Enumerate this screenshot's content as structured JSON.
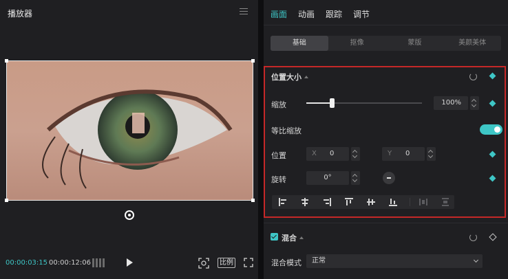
{
  "player": {
    "title": "播放器",
    "current_time": "00:00:03:15",
    "total_time": "00:00:12:06",
    "ratio_label": "比例"
  },
  "tabs": [
    "画面",
    "动画",
    "跟踪",
    "调节"
  ],
  "subtabs": [
    "基础",
    "抠像",
    "蒙版",
    "美颜美体"
  ],
  "position_size": {
    "title": "位置大小",
    "scale_label": "缩放",
    "scale_value": "100%",
    "scale_fraction": 0.22,
    "uniform_scale_label": "等比缩放",
    "uniform_scale_on": true,
    "position_label": "位置",
    "x_label": "X",
    "x_value": "0",
    "y_label": "Y",
    "y_value": "0",
    "rotation_label": "旋转",
    "rotation_value": "0°"
  },
  "blend": {
    "title": "混合",
    "mode_label": "混合模式",
    "mode_value": "正常"
  },
  "colors": {
    "accent": "#3ec6c6",
    "highlight_border": "#c62828"
  }
}
